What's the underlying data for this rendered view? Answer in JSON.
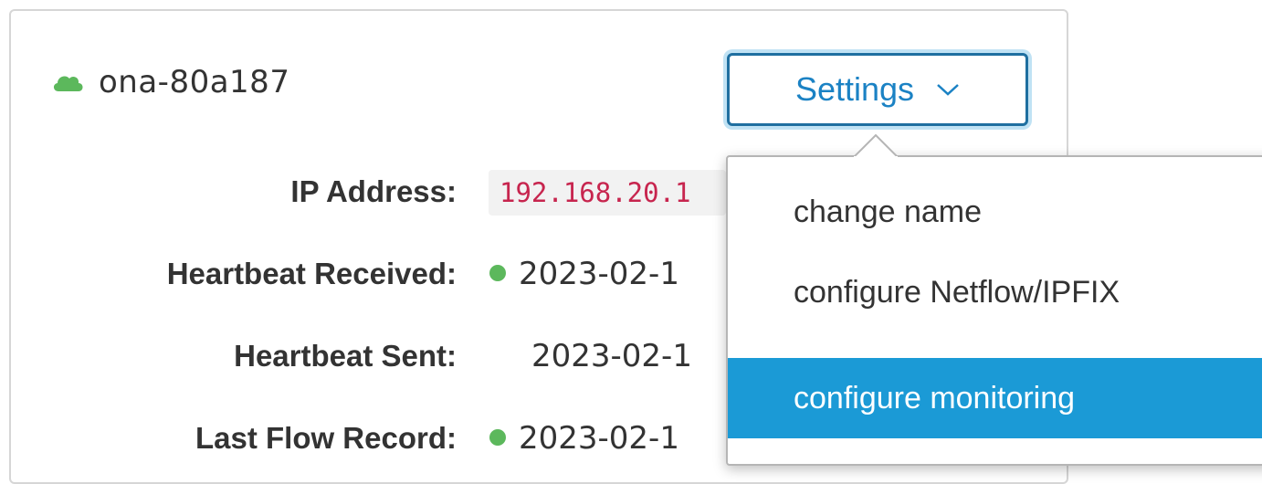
{
  "sensor": {
    "name": "ona-80a187",
    "status_icon": "cloud-icon",
    "status_color": "#5cb85c"
  },
  "settings": {
    "label": "Settings",
    "menu": [
      {
        "label": "change name",
        "active": false
      },
      {
        "label": "configure Netflow/IPFIX",
        "active": false
      },
      {
        "label": "configure monitoring",
        "active": true
      }
    ]
  },
  "details": {
    "ip_label": "IP Address:",
    "ip_value": "192.168.20.1",
    "hb_received_label": "Heartbeat Received:",
    "hb_received_value": "2023-02-1",
    "hb_sent_label": "Heartbeat Sent:",
    "hb_sent_value": "2023-02-1",
    "last_flow_label": "Last Flow Record:",
    "last_flow_value": "2023-02-1"
  },
  "colors": {
    "accent": "#1b82c4",
    "highlight": "#1b9ad6",
    "ip_text": "#c7254e",
    "status_green": "#5cb85c"
  }
}
